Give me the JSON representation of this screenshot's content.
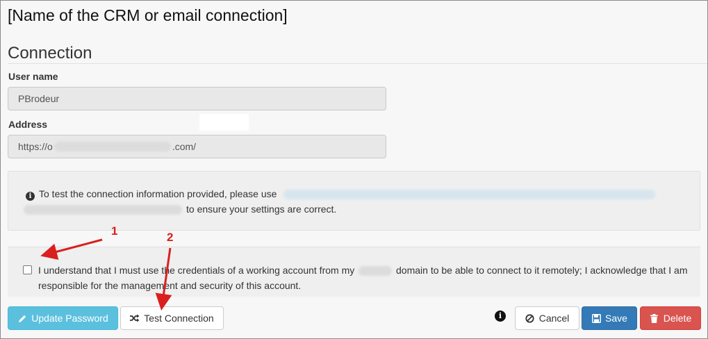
{
  "header": {
    "title": "[Name of the CRM or email connection]"
  },
  "section": {
    "title": "Connection"
  },
  "fields": {
    "username": {
      "label": "User name",
      "value": "PBrodeur"
    },
    "address": {
      "label": "Address",
      "value_prefix": "https://o",
      "value_suffix": ".com/"
    }
  },
  "info": {
    "line1": "To test the connection information provided, please use",
    "line2": "to ensure your settings are correct.",
    "icon": "info-circle-icon"
  },
  "acknowledge": {
    "text_before": "I understand that I must use the credentials of a working account from my",
    "text_after": "domain to be able to connect to it remotely; I acknowledge that I am responsible for the management and security of this account.",
    "checked": false
  },
  "buttons": {
    "update_password": {
      "label": "Update Password",
      "icon": "pencil-icon"
    },
    "test_connection": {
      "label": "Test Connection",
      "icon": "shuffle-icon"
    },
    "cancel": {
      "label": "Cancel",
      "icon": "ban-icon"
    },
    "save": {
      "label": "Save",
      "icon": "floppy-disk-icon"
    },
    "delete": {
      "label": "Delete",
      "icon": "trash-icon"
    }
  },
  "annotations": {
    "marker1": "1",
    "marker2": "2",
    "color": "#d9201f"
  },
  "colors": {
    "info": "#5bc0de",
    "primary": "#337ab7",
    "danger": "#d9534f"
  }
}
